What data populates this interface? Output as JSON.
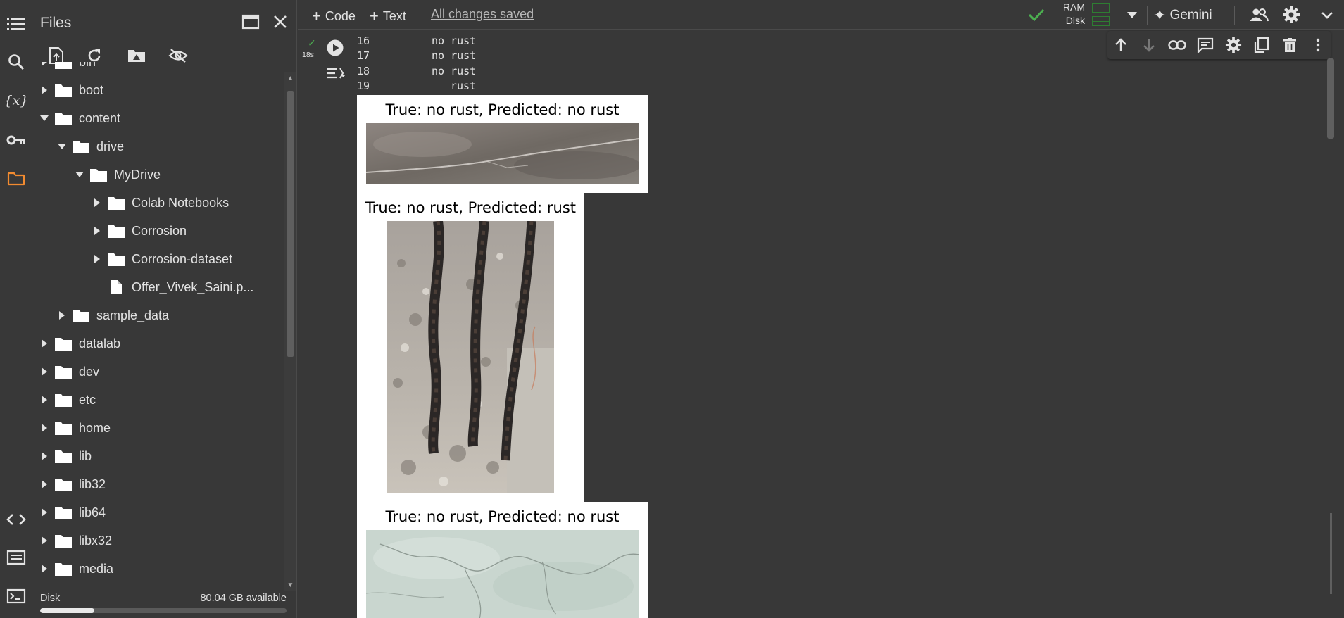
{
  "sidebar_rail": {
    "icons": [
      "table-of-contents-icon",
      "search-icon",
      "variables-icon",
      "secrets-key-icon",
      "folder-icon",
      "code-snippets-icon",
      "command-palette-icon",
      "terminal-icon"
    ]
  },
  "files_panel": {
    "title": "Files",
    "toolbar": [
      "upload-icon",
      "refresh-icon",
      "mount-drive-icon",
      "hide-files-icon"
    ],
    "tree": [
      {
        "name": "bin",
        "type": "folder",
        "depth": 0,
        "expanded": false
      },
      {
        "name": "boot",
        "type": "folder",
        "depth": 0,
        "expanded": false
      },
      {
        "name": "content",
        "type": "folder",
        "depth": 0,
        "expanded": true
      },
      {
        "name": "drive",
        "type": "folder",
        "depth": 1,
        "expanded": true
      },
      {
        "name": "MyDrive",
        "type": "folder",
        "depth": 2,
        "expanded": true
      },
      {
        "name": "Colab Notebooks",
        "type": "folder",
        "depth": 3,
        "expanded": false
      },
      {
        "name": "Corrosion",
        "type": "folder",
        "depth": 3,
        "expanded": false
      },
      {
        "name": "Corrosion-dataset",
        "type": "folder",
        "depth": 3,
        "expanded": false
      },
      {
        "name": "Offer_Vivek_Saini.p...",
        "type": "file",
        "depth": 3,
        "expanded": false
      },
      {
        "name": "sample_data",
        "type": "folder",
        "depth": 1,
        "expanded": false
      },
      {
        "name": "datalab",
        "type": "folder",
        "depth": 0,
        "expanded": false
      },
      {
        "name": "dev",
        "type": "folder",
        "depth": 0,
        "expanded": false
      },
      {
        "name": "etc",
        "type": "folder",
        "depth": 0,
        "expanded": false
      },
      {
        "name": "home",
        "type": "folder",
        "depth": 0,
        "expanded": false
      },
      {
        "name": "lib",
        "type": "folder",
        "depth": 0,
        "expanded": false
      },
      {
        "name": "lib32",
        "type": "folder",
        "depth": 0,
        "expanded": false
      },
      {
        "name": "lib64",
        "type": "folder",
        "depth": 0,
        "expanded": false
      },
      {
        "name": "libx32",
        "type": "folder",
        "depth": 0,
        "expanded": false
      },
      {
        "name": "media",
        "type": "folder",
        "depth": 0,
        "expanded": false
      }
    ],
    "disk": {
      "label": "Disk",
      "available": "80.04 GB available",
      "used_fraction": 0.22
    }
  },
  "topbar": {
    "code_label": "Code",
    "text_label": "Text",
    "saved_status": "All changes saved",
    "ram_label": "RAM",
    "disk_label": "Disk",
    "gemini_label": "Gemini"
  },
  "cell": {
    "exec_time": "18s",
    "text_output": [
      {
        "index": "16",
        "value": "no rust"
      },
      {
        "index": "17",
        "value": "no rust"
      },
      {
        "index": "18",
        "value": "no rust"
      },
      {
        "index": "19",
        "value": "rust"
      }
    ],
    "figures": [
      {
        "title": "True: no rust, Predicted: no rust"
      },
      {
        "title": "True: no rust, Predicted: rust"
      },
      {
        "title": "True: no rust, Predicted: no rust"
      }
    ]
  },
  "colors": {
    "background": "#383838",
    "accent_orange": "#f28b30",
    "check_green": "#4caf50"
  }
}
